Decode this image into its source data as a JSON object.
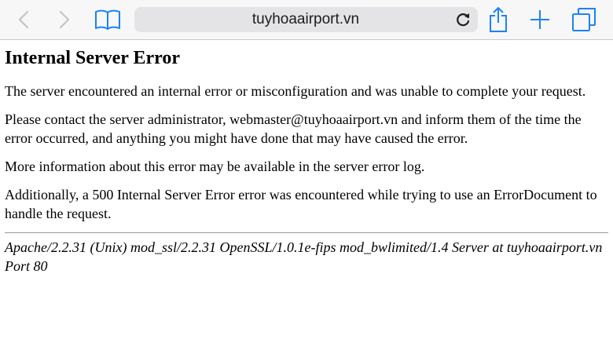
{
  "browser": {
    "url": "tuyhoaairport.vn",
    "icons": {
      "back": "chevron-left-icon",
      "forward": "chevron-right-icon",
      "bookmarks": "book-icon",
      "reload": "reload-icon",
      "share": "share-icon",
      "new_tab": "plus-icon",
      "tabs": "tabs-icon"
    },
    "accent": "#1a82fb",
    "disabled_color": "#c4c4c4"
  },
  "page": {
    "heading": "Internal Server Error",
    "paragraphs": [
      "The server encountered an internal error or misconfiguration and was unable to complete your request.",
      "Please contact the server administrator, webmaster@tuyhoaairport.vn and inform them of the time the error occurred, and anything you might have done that may have caused the error.",
      "More information about this error may be available in the server error log.",
      "Additionally, a 500 Internal Server Error error was encountered while trying to use an ErrorDocument to handle the request."
    ],
    "signature": "Apache/2.2.31 (Unix) mod_ssl/2.2.31 OpenSSL/1.0.1e-fips mod_bwlimited/1.4 Server at tuyhoaairport.vn Port 80"
  }
}
